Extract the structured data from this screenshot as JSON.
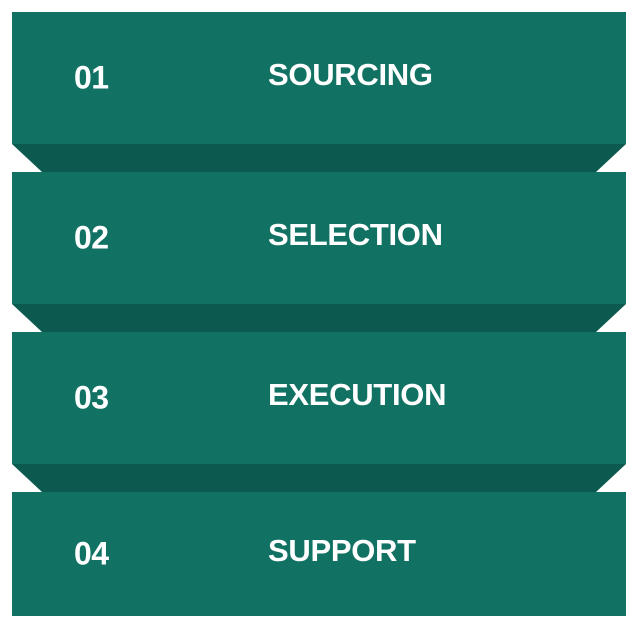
{
  "colors": {
    "band": "#117264",
    "fold": "#0c5a4f",
    "text": "#ffffff"
  },
  "steps": [
    {
      "number": "01",
      "label": "SOURCING"
    },
    {
      "number": "02",
      "label": "SELECTION"
    },
    {
      "number": "03",
      "label": "EXECUTION"
    },
    {
      "number": "04",
      "label": "SUPPORT"
    }
  ]
}
